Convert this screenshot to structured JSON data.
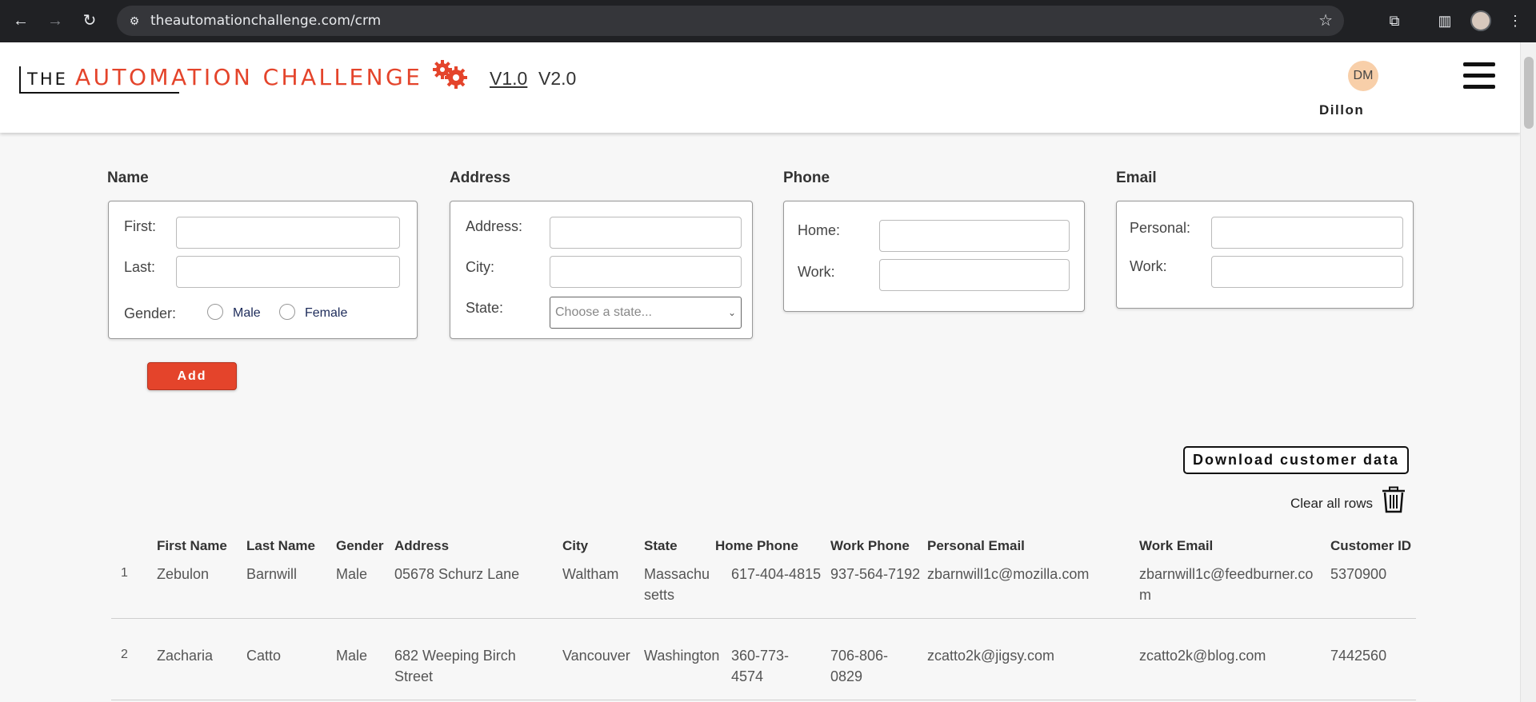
{
  "browser": {
    "url": "theautomationchallenge.com/crm"
  },
  "header": {
    "logo_the": "THE",
    "logo_main": "AUTOMATION CHALLENGE",
    "version_1": "V1.0",
    "version_2": "V2.0",
    "avatar_initials": "DM",
    "username": "Dillon"
  },
  "form": {
    "name": {
      "title": "Name",
      "first_label": "First:",
      "last_label": "Last:",
      "gender_label": "Gender:",
      "male_label": "Male",
      "female_label": "Female"
    },
    "address": {
      "title": "Address",
      "address_label": "Address:",
      "city_label": "City:",
      "state_label": "State:",
      "state_placeholder": "Choose a state..."
    },
    "phone": {
      "title": "Phone",
      "home_label": "Home:",
      "work_label": "Work:"
    },
    "email": {
      "title": "Email",
      "personal_label": "Personal:",
      "work_label": "Work:"
    },
    "add_label": "Add"
  },
  "actions": {
    "download_label": "Download customer data",
    "clear_label": "Clear all rows"
  },
  "table": {
    "headers": [
      "First Name",
      "Last Name",
      "Gender",
      "Address",
      "City",
      "State",
      "Home Phone",
      "Work Phone",
      "Personal Email",
      "Work Email",
      "Customer ID"
    ],
    "rows": [
      {
        "num": "1",
        "first": "Zebulon",
        "last": "Barnwill",
        "gender": "Male",
        "address": "05678 Schurz Lane",
        "city": "Waltham",
        "state": "Massachusetts",
        "home_phone": "617-404-4815",
        "work_phone": "937-564-7192",
        "personal_email": "zbarnwill1c@mozilla.com",
        "work_email": "zbarnwill1c@feedburner.com",
        "customer_id": "5370900"
      },
      {
        "num": "2",
        "first": "Zacharia",
        "last": "Catto",
        "gender": "Male",
        "address": "682 Weeping Birch Street",
        "city": "Vancouver",
        "state": "Washington",
        "home_phone": "360-773-4574",
        "work_phone": "706-806-0829",
        "personal_email": "zcatto2k@jigsy.com",
        "work_email": "zcatto2k@blog.com",
        "customer_id": "7442560"
      }
    ]
  }
}
